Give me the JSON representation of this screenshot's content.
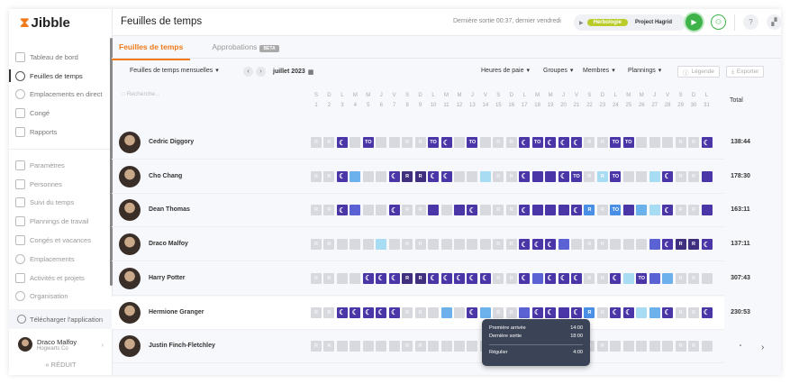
{
  "app": {
    "logo": "Jibble",
    "logo_icon": "hourglass-icon"
  },
  "sidebar": {
    "items": [
      {
        "label": "Tableau de bord",
        "icon": "dashboard-icon"
      },
      {
        "label": "Feuilles de temps",
        "icon": "clock-icon",
        "active": true
      },
      {
        "label": "Emplacements en direct",
        "icon": "location-icon"
      },
      {
        "label": "Congé",
        "icon": "suitcase-icon"
      },
      {
        "label": "Rapports",
        "icon": "report-icon"
      }
    ],
    "settings_items": [
      {
        "label": "Paramètres",
        "icon": "chevron-up-icon"
      },
      {
        "label": "Personnes",
        "icon": "people-icon"
      },
      {
        "label": "Suivi du temps",
        "icon": "time-tracking-icon"
      },
      {
        "label": "Plannings de travail",
        "icon": "schedule-icon"
      },
      {
        "label": "Congés et vacances",
        "icon": "suitcase-icon"
      },
      {
        "label": "Emplacements",
        "icon": "location-icon"
      },
      {
        "label": "Activités et projets",
        "icon": "tag-icon"
      },
      {
        "label": "Organisation",
        "icon": "gear-icon"
      }
    ],
    "download": "Télécharger l'application",
    "user": {
      "name": "Draco Malfoy",
      "org": "Hogwarts Co"
    },
    "collapse": "« RÉDUIT"
  },
  "header": {
    "title": "Feuilles de temps",
    "last_out": "Dernière sortie 00:37, dernier vendredi",
    "activity": "Herbologie",
    "project": "Project Hagrid"
  },
  "tabs": [
    {
      "label": "Feuilles de temps",
      "active": true
    },
    {
      "label": "Approbations",
      "badge": "BETA"
    }
  ],
  "toolbar": {
    "view": "Feuilles de temps mensuelles",
    "month": "juillet 2023",
    "filters": [
      "Heures de paie",
      "Groupes",
      "Membres",
      "Plannings"
    ],
    "legend": "Légende",
    "export": "Exporter"
  },
  "search_placeholder": "Recherche...",
  "days": {
    "letters": [
      "S",
      "D",
      "L",
      "M",
      "M",
      "J",
      "V",
      "S",
      "D",
      "L",
      "M",
      "M",
      "J",
      "V",
      "S",
      "D",
      "L",
      "M",
      "M",
      "J",
      "V",
      "S",
      "D",
      "L",
      "M",
      "M",
      "J",
      "V",
      "S",
      "D",
      "L"
    ]
  },
  "total_label": "Total",
  "legend_colors": {
    "e": "#d7d9de",
    "R": "#d7d9de",
    "m": "#4a36a6",
    "T": "#4a36a6",
    "P": "#4a36a6",
    "r": "#3f2f7e",
    "B": "#5a62d4",
    "L": "#a8dcf3",
    "S": "#6cb0ec",
    "b": "#4a8fe6",
    "lr": "#a8dcf3",
    "Tb": "#4a8fe6"
  },
  "employees": [
    {
      "name": "Cedric Diggory",
      "total": "138:44",
      "days": [
        "R",
        "R",
        "m",
        "e",
        "T",
        "e",
        "e",
        "R",
        "R",
        "T",
        "m",
        "e",
        "T",
        "e",
        "R",
        "R",
        "m",
        "T",
        "m",
        "m",
        "m",
        "R",
        "R",
        "T",
        "T",
        "e",
        "e",
        "e",
        "R",
        "R",
        "m"
      ]
    },
    {
      "name": "Cho Chang",
      "total": "178:30",
      "days": [
        "R",
        "R",
        "m",
        "S",
        "e",
        "e",
        "m",
        "r",
        "r",
        "m",
        "m",
        "e",
        "e",
        "L",
        "R",
        "R",
        "m",
        "P",
        "P",
        "m",
        "T",
        "R",
        "lr",
        "T",
        "e",
        "e",
        "L",
        "m",
        "R",
        "R",
        "P"
      ]
    },
    {
      "name": "Dean Thomas",
      "total": "163:11",
      "days": [
        "R",
        "R",
        "m",
        "B",
        "e",
        "e",
        "m",
        "R",
        "R",
        "P",
        "e",
        "P",
        "m",
        "e",
        "R",
        "R",
        "m",
        "P",
        "P",
        "P",
        "m",
        "b",
        "R",
        "Tb",
        "P",
        "S",
        "L",
        "m",
        "R",
        "R",
        "P"
      ]
    },
    {
      "name": "Draco Malfoy",
      "total": "137:11",
      "days": [
        "R",
        "R",
        "e",
        "e",
        "e",
        "L",
        "e",
        "R",
        "R",
        "e",
        "e",
        "e",
        "e",
        "e",
        "R",
        "R",
        "m",
        "m",
        "m",
        "B",
        "e",
        "R",
        "R",
        "e",
        "e",
        "e",
        "B",
        "m",
        "r",
        "r",
        "m"
      ]
    },
    {
      "name": "Harry Potter",
      "total": "307:43",
      "days": [
        "R",
        "R",
        "e",
        "e",
        "m",
        "m",
        "m",
        "r",
        "r",
        "m",
        "m",
        "m",
        "m",
        "m",
        "R",
        "R",
        "m",
        "B",
        "m",
        "m",
        "m",
        "R",
        "R",
        "m",
        "L",
        "T",
        "B",
        "S",
        "R",
        "R",
        "e"
      ]
    },
    {
      "name": "Hermione Granger",
      "total": "230:53",
      "days": [
        "R",
        "R",
        "m",
        "m",
        "m",
        "m",
        "m",
        "R",
        "R",
        "e",
        "S",
        "e",
        "m",
        "S",
        "R",
        "R",
        "B",
        "m",
        "m",
        "P",
        "m",
        "b",
        "R",
        "m",
        "m",
        "L",
        "S",
        "m",
        "R",
        "R",
        "m"
      ]
    },
    {
      "name": "Justin Finch-Fletchley",
      "total": "-",
      "days": [
        "R",
        "R",
        "e",
        "e",
        "e",
        "e",
        "e",
        "R",
        "R",
        "e",
        "e",
        "e",
        "e",
        "e",
        "R",
        "R",
        "e",
        "e",
        "e",
        "e",
        "e",
        "R",
        "R",
        "e",
        "e",
        "e",
        "e",
        "e",
        "R",
        "R",
        "e"
      ]
    }
  ],
  "tooltip": {
    "first_in_label": "Première arrivée",
    "first_in": "14:00",
    "last_out_label": "Dernière sortie",
    "last_out": "18:00",
    "regular_label": "Régulier",
    "regular": "4:00"
  }
}
